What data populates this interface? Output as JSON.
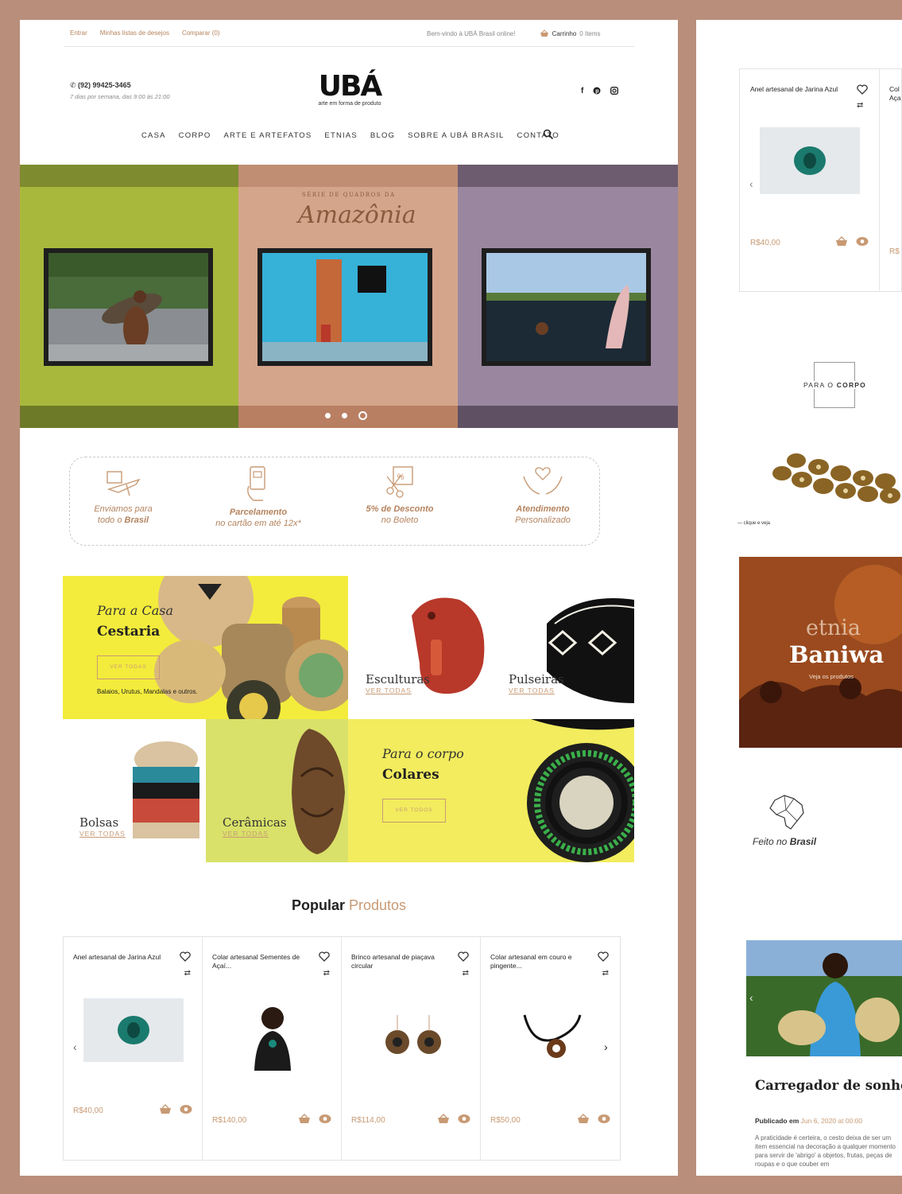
{
  "topbar": {
    "links": [
      "Entrar",
      "Minhas listas de desejos",
      "Comparar (0)"
    ],
    "welcome": "Bem-vindo à UBÁ Brasil online!",
    "cart_label": "Carrinho",
    "cart_count": "0 Items"
  },
  "header": {
    "phone": "(92) 99425-3465",
    "hours": "7 dias por semana, das 9:00 às 21:00",
    "logo_word": "UBÁ",
    "logo_tagline": "arte em forma de produto",
    "social_icons": [
      "facebook-icon",
      "pinterest-icon",
      "instagram-icon"
    ]
  },
  "nav": [
    "CASA",
    "CORPO",
    "ARTE E ARTEFATOS",
    "ETNIAS",
    "BLOG",
    "SOBRE A UBÁ BRASIL",
    "CONTATO"
  ],
  "hero": {
    "script_top": "SÉRIE DE QUADROS DA",
    "script_title": "Amazônia",
    "slides": 3,
    "active_slide": 3,
    "panel_colors": [
      "#a8b83d",
      "#d4a58a",
      "#9a879f"
    ]
  },
  "perks": [
    {
      "line1": "Enviamos para",
      "line2a": "todo o ",
      "line2b": "Brasil",
      "icon": "airplane-box-icon"
    },
    {
      "line1": "Parcelamento",
      "line2a": "no cartão em até 12x*",
      "line2b": "",
      "icon": "card-hand-icon"
    },
    {
      "line1": "5% de Desconto",
      "line2a": "no Boleto",
      "line2b": "",
      "icon": "coupon-icon"
    },
    {
      "line1": "Atendimento",
      "line2a": "Personalizado",
      "line2b": "",
      "icon": "hands-heart-icon"
    }
  ],
  "categories": {
    "casa": {
      "kicker": "Para a Casa",
      "title": "Cestaria",
      "button": "VER TODAS",
      "desc": "Balaios, Urutus, Mandalas e outros."
    },
    "esculturas": {
      "title": "Esculturas",
      "link": "VER TODAS"
    },
    "pulseiras": {
      "title": "Pulseiras",
      "link": "VER TODAS"
    },
    "bolsas": {
      "title": "Bolsas",
      "link": "VER TODAS"
    },
    "ceramicas": {
      "title": "Cerâmicas",
      "link": "VER TODAS"
    },
    "corpo": {
      "kicker": "Para o corpo",
      "title": "Colares",
      "button": "VER TODOS"
    }
  },
  "popular": {
    "title_a": "Popular ",
    "title_b": "Produtos",
    "products": [
      {
        "name": "Anel artesanal de Jarina Azul",
        "price": "R$40,00"
      },
      {
        "name": "Colar artesanal Sementes de Açaí...",
        "price": "R$140,00"
      },
      {
        "name": "Brinco artesanal de piaçava circular",
        "price": "R$114,00"
      },
      {
        "name": "Colar artesanal em couro e pingente...",
        "price": "R$50,00"
      }
    ]
  },
  "sidebar": {
    "product_name": "Anel artesanal de Jarina Azul",
    "product_price": "R$40,00",
    "next_name": "Col Aça",
    "next_price": "R$",
    "corpo_label_a": "PARA O ",
    "corpo_label_b": "CORPO",
    "corpo_caption": "— clique e veja",
    "etnia_kicker": "etnia",
    "etnia_name": "Baniwa",
    "etnia_sub": "Veja os produtos",
    "feito_a": "Feito no ",
    "feito_b": "Brasil",
    "blog_title": "Carregador de sonhos com bateria vegetal",
    "blog_meta_a": "Publicado em ",
    "blog_meta_b": "Jun 6, 2020 at 00:00",
    "blog_excerpt": "A praticidade é certeira, o cesto deixa de ser um item essencial na decoração a qualquer momento para servir de 'abrigo' a objetos, frutas, peças de roupas e o que couber em"
  }
}
